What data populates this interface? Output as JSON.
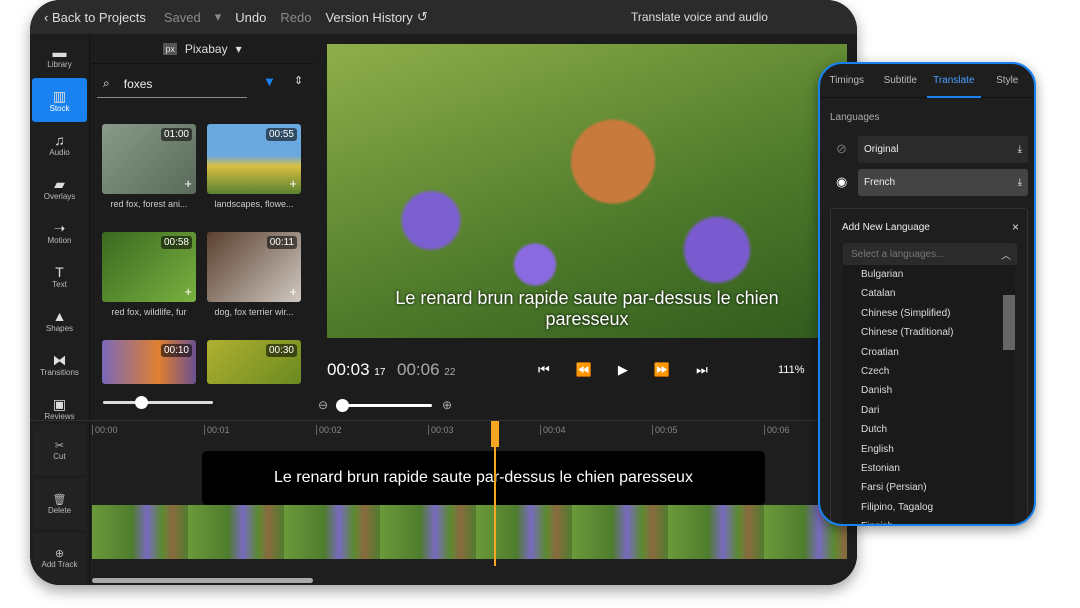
{
  "topbar": {
    "back": "Back to Projects",
    "saved": "Saved",
    "undo": "Undo",
    "redo": "Redo",
    "version_history": "Version History",
    "title": "Translate voice and audio"
  },
  "sidebar": {
    "items": [
      {
        "label": "Library",
        "icon": "folder-icon"
      },
      {
        "label": "Stock",
        "icon": "books-icon",
        "active": true
      },
      {
        "label": "Audio",
        "icon": "music-icon"
      },
      {
        "label": "Overlays",
        "icon": "overlay-icon"
      },
      {
        "label": "Motion",
        "icon": "motion-icon"
      },
      {
        "label": "Text",
        "icon": "text-icon"
      },
      {
        "label": "Shapes",
        "icon": "shapes-icon"
      },
      {
        "label": "Transitions",
        "icon": "transitions-icon"
      },
      {
        "label": "Reviews",
        "icon": "chat-icon"
      }
    ]
  },
  "stock": {
    "source": "Pixabay",
    "search_value": "foxes",
    "items": [
      {
        "duration": "01:00",
        "caption": "red fox, forest ani..."
      },
      {
        "duration": "00:55",
        "caption": "landscapes, flowe..."
      },
      {
        "duration": "00:58",
        "caption": "red fox, wildlife, fur"
      },
      {
        "duration": "00:11",
        "caption": "dog, fox terrier wir..."
      },
      {
        "duration": "00:10",
        "caption": ""
      },
      {
        "duration": "00:30",
        "caption": ""
      }
    ]
  },
  "player": {
    "subtitle": "Le renard brun rapide saute par-dessus le chien paresseux",
    "current_time": "00:03",
    "current_frame": "17",
    "total_time": "00:06",
    "total_frame": "22",
    "zoom": "111%"
  },
  "timeline": {
    "tools": [
      "Cut",
      "Delete",
      "Add Track"
    ],
    "ticks": [
      "00:00",
      "00:01",
      "00:02",
      "00:03",
      "00:04",
      "00:05",
      "00:06"
    ],
    "caption": "Le renard brun rapide saute par-dessus le chien paresseux",
    "accent": "#f5a623"
  },
  "panel": {
    "tabs": [
      "Timings",
      "Subtitle",
      "Translate",
      "Style"
    ],
    "active_tab": "Translate",
    "languages_label": "Languages",
    "languages": [
      "Original",
      "French"
    ],
    "add_title": "Add New Language",
    "placeholder": "Select a languages...",
    "options": [
      "Bulgarian",
      "Catalan",
      "Chinese (Simplified)",
      "Chinese (Traditional)",
      "Croatian",
      "Czech",
      "Danish",
      "Dari",
      "Dutch",
      "English",
      "Estonian",
      "Farsi (Persian)",
      "Filipino, Tagalog",
      "Finnish"
    ],
    "accent": "#1a82f0"
  }
}
